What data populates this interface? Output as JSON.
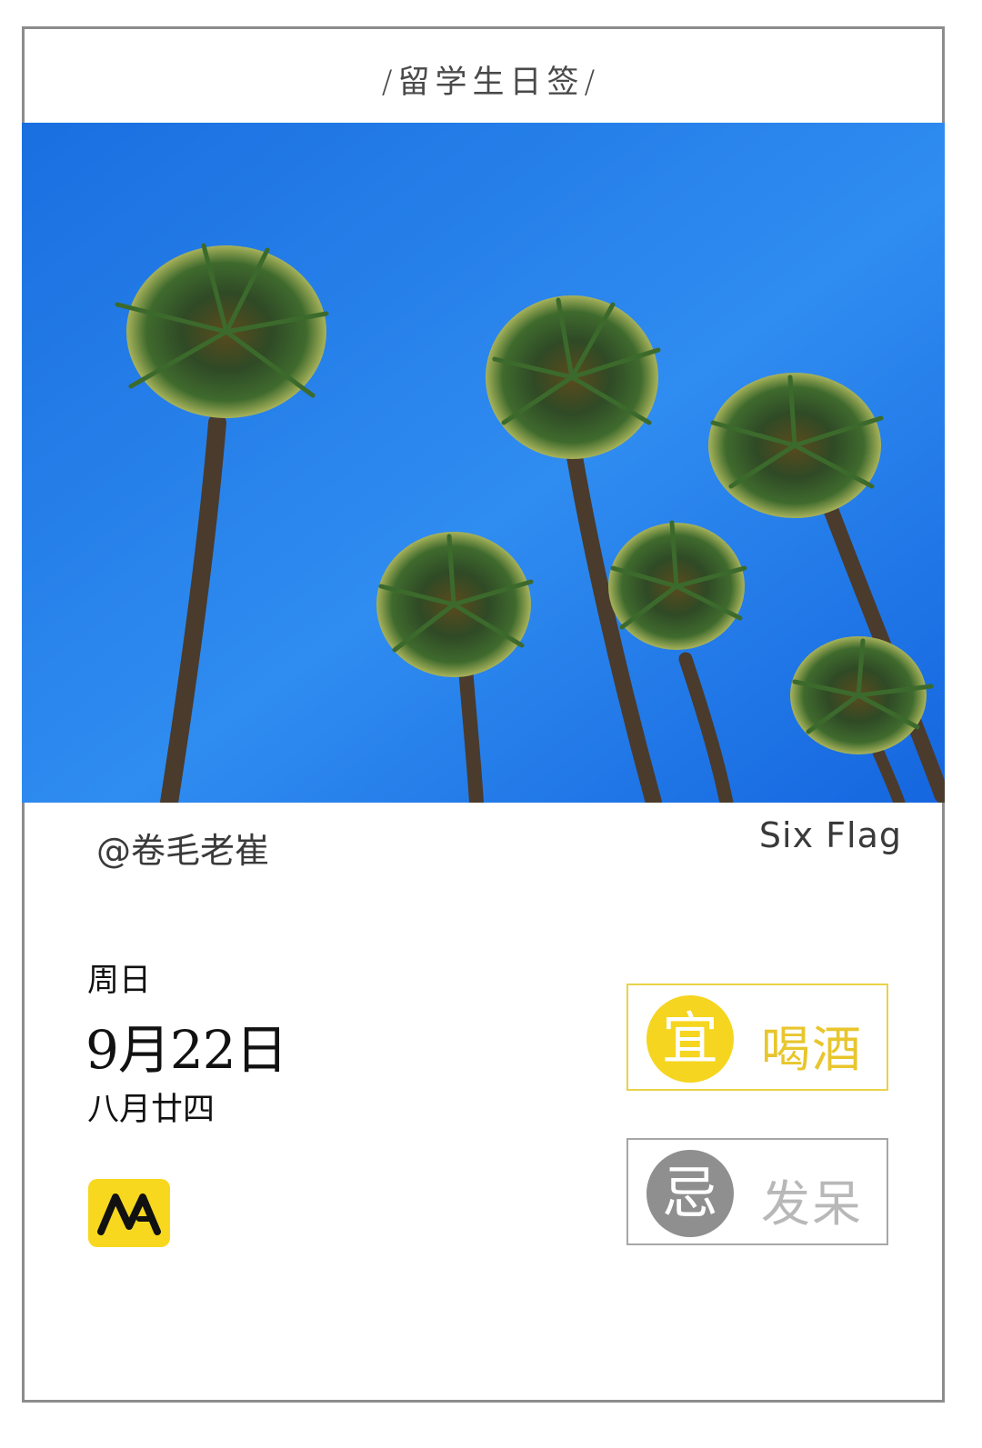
{
  "header": {
    "title": "/留学生日签/"
  },
  "photo": {
    "description_icon": "palm-trees-sky-photo"
  },
  "meta": {
    "author": "@卷毛老崔",
    "location": "Six Flag"
  },
  "date": {
    "weekday": "周日",
    "solar": "9月22日",
    "lunar": "八月廿四"
  },
  "logo": {
    "text": "MA",
    "color": "#f7d81f"
  },
  "yi": {
    "label": "宜",
    "activity": "喝酒",
    "color": "#f5d51f"
  },
  "ji": {
    "label": "忌",
    "activity": "发呆",
    "color": "#8f8f8f"
  }
}
